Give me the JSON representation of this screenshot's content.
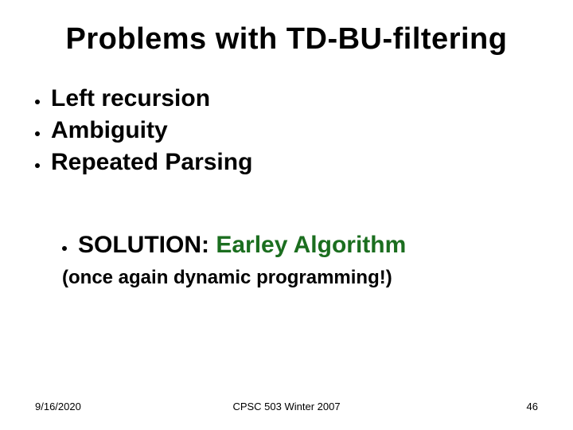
{
  "title": "Problems with TD-BU-filtering",
  "bullets": [
    "Left recursion",
    "Ambiguity",
    "Repeated Parsing"
  ],
  "solution": {
    "label": "SOLUTION:",
    "highlight": "Earley Algorithm",
    "parenthetical": "(once again dynamic programming!)"
  },
  "footer": {
    "left": "9/16/2020",
    "center": "CPSC 503 Winter 2007",
    "right": "46"
  }
}
